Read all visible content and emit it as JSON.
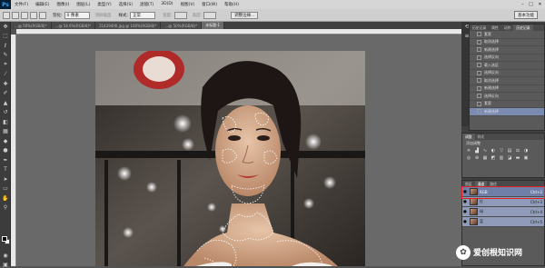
{
  "app": {
    "logo": "Ps"
  },
  "menubar": {
    "items": [
      "文件(F)",
      "编辑(E)",
      "图像(I)",
      "图层(L)",
      "类型(Y)",
      "选择(S)",
      "滤镜(T)",
      "3D(D)",
      "视图(V)",
      "窗口(W)",
      "帮助(H)"
    ]
  },
  "optionsbar": {
    "feather_label": "羽化:",
    "feather_value": "0 像素",
    "antialias_label": "消除锯齿",
    "style_label": "样式:",
    "style_value": "正常",
    "width_label": "宽度:",
    "height_label": "高度:",
    "refine_edge": "调整边缘...",
    "workspace": "基本功能"
  },
  "tabs": [
    {
      "label": "...@ 50%(RGB/8)*",
      "active": false
    },
    {
      "label": "...@ 54.6%(RGB/8)*",
      "active": false
    },
    {
      "label": "214294f4l.jpg @ 100%(RGB/8)*",
      "active": false
    },
    {
      "label": "...@ 50%(RGB/8)*",
      "active": false
    },
    {
      "label": "未标题-1",
      "active": true
    }
  ],
  "history": {
    "tabs": [
      "历史记录",
      "属性",
      "动作",
      "历史记录"
    ],
    "rows": [
      "套索",
      "取消选择",
      "新建选择",
      "选择反向",
      "载入选区",
      "选择反向",
      "取消选择",
      "新建选择",
      "选择反向",
      "套索",
      "新建选择"
    ],
    "selected_index": 10
  },
  "adjustments": {
    "tabs": [
      "调整",
      "样式"
    ],
    "title": "添加调整"
  },
  "layers": {
    "tabs": [
      "图层",
      "通道",
      "路径"
    ],
    "rows": [
      {
        "name": "RGB",
        "key": "Ctrl+2",
        "highlight": true
      },
      {
        "name": "红",
        "key": "Ctrl+3",
        "highlight": false
      },
      {
        "name": "绿",
        "key": "Ctrl+4",
        "highlight": false
      },
      {
        "name": "蓝",
        "key": "Ctrl+5",
        "highlight": false
      }
    ]
  },
  "watermark": {
    "text": "爱创根知识网"
  },
  "colors": {
    "accent_red": "#e02020",
    "selection_blue": "#7a8ab0"
  }
}
